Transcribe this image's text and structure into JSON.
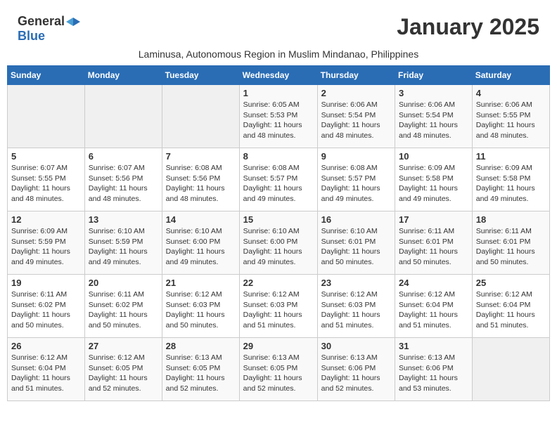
{
  "logo": {
    "general": "General",
    "blue": "Blue"
  },
  "title": "January 2025",
  "subtitle": "Laminusa, Autonomous Region in Muslim Mindanao, Philippines",
  "days_of_week": [
    "Sunday",
    "Monday",
    "Tuesday",
    "Wednesday",
    "Thursday",
    "Friday",
    "Saturday"
  ],
  "weeks": [
    [
      {
        "day": "",
        "sunrise": "",
        "sunset": "",
        "daylight": "",
        "empty": true
      },
      {
        "day": "",
        "sunrise": "",
        "sunset": "",
        "daylight": "",
        "empty": true
      },
      {
        "day": "",
        "sunrise": "",
        "sunset": "",
        "daylight": "",
        "empty": true
      },
      {
        "day": "1",
        "sunrise": "Sunrise: 6:05 AM",
        "sunset": "Sunset: 5:53 PM",
        "daylight": "Daylight: 11 hours and 48 minutes."
      },
      {
        "day": "2",
        "sunrise": "Sunrise: 6:06 AM",
        "sunset": "Sunset: 5:54 PM",
        "daylight": "Daylight: 11 hours and 48 minutes."
      },
      {
        "day": "3",
        "sunrise": "Sunrise: 6:06 AM",
        "sunset": "Sunset: 5:54 PM",
        "daylight": "Daylight: 11 hours and 48 minutes."
      },
      {
        "day": "4",
        "sunrise": "Sunrise: 6:06 AM",
        "sunset": "Sunset: 5:55 PM",
        "daylight": "Daylight: 11 hours and 48 minutes."
      }
    ],
    [
      {
        "day": "5",
        "sunrise": "Sunrise: 6:07 AM",
        "sunset": "Sunset: 5:55 PM",
        "daylight": "Daylight: 11 hours and 48 minutes."
      },
      {
        "day": "6",
        "sunrise": "Sunrise: 6:07 AM",
        "sunset": "Sunset: 5:56 PM",
        "daylight": "Daylight: 11 hours and 48 minutes."
      },
      {
        "day": "7",
        "sunrise": "Sunrise: 6:08 AM",
        "sunset": "Sunset: 5:56 PM",
        "daylight": "Daylight: 11 hours and 48 minutes."
      },
      {
        "day": "8",
        "sunrise": "Sunrise: 6:08 AM",
        "sunset": "Sunset: 5:57 PM",
        "daylight": "Daylight: 11 hours and 49 minutes."
      },
      {
        "day": "9",
        "sunrise": "Sunrise: 6:08 AM",
        "sunset": "Sunset: 5:57 PM",
        "daylight": "Daylight: 11 hours and 49 minutes."
      },
      {
        "day": "10",
        "sunrise": "Sunrise: 6:09 AM",
        "sunset": "Sunset: 5:58 PM",
        "daylight": "Daylight: 11 hours and 49 minutes."
      },
      {
        "day": "11",
        "sunrise": "Sunrise: 6:09 AM",
        "sunset": "Sunset: 5:58 PM",
        "daylight": "Daylight: 11 hours and 49 minutes."
      }
    ],
    [
      {
        "day": "12",
        "sunrise": "Sunrise: 6:09 AM",
        "sunset": "Sunset: 5:59 PM",
        "daylight": "Daylight: 11 hours and 49 minutes."
      },
      {
        "day": "13",
        "sunrise": "Sunrise: 6:10 AM",
        "sunset": "Sunset: 5:59 PM",
        "daylight": "Daylight: 11 hours and 49 minutes."
      },
      {
        "day": "14",
        "sunrise": "Sunrise: 6:10 AM",
        "sunset": "Sunset: 6:00 PM",
        "daylight": "Daylight: 11 hours and 49 minutes."
      },
      {
        "day": "15",
        "sunrise": "Sunrise: 6:10 AM",
        "sunset": "Sunset: 6:00 PM",
        "daylight": "Daylight: 11 hours and 49 minutes."
      },
      {
        "day": "16",
        "sunrise": "Sunrise: 6:10 AM",
        "sunset": "Sunset: 6:01 PM",
        "daylight": "Daylight: 11 hours and 50 minutes."
      },
      {
        "day": "17",
        "sunrise": "Sunrise: 6:11 AM",
        "sunset": "Sunset: 6:01 PM",
        "daylight": "Daylight: 11 hours and 50 minutes."
      },
      {
        "day": "18",
        "sunrise": "Sunrise: 6:11 AM",
        "sunset": "Sunset: 6:01 PM",
        "daylight": "Daylight: 11 hours and 50 minutes."
      }
    ],
    [
      {
        "day": "19",
        "sunrise": "Sunrise: 6:11 AM",
        "sunset": "Sunset: 6:02 PM",
        "daylight": "Daylight: 11 hours and 50 minutes."
      },
      {
        "day": "20",
        "sunrise": "Sunrise: 6:11 AM",
        "sunset": "Sunset: 6:02 PM",
        "daylight": "Daylight: 11 hours and 50 minutes."
      },
      {
        "day": "21",
        "sunrise": "Sunrise: 6:12 AM",
        "sunset": "Sunset: 6:03 PM",
        "daylight": "Daylight: 11 hours and 50 minutes."
      },
      {
        "day": "22",
        "sunrise": "Sunrise: 6:12 AM",
        "sunset": "Sunset: 6:03 PM",
        "daylight": "Daylight: 11 hours and 51 minutes."
      },
      {
        "day": "23",
        "sunrise": "Sunrise: 6:12 AM",
        "sunset": "Sunset: 6:03 PM",
        "daylight": "Daylight: 11 hours and 51 minutes."
      },
      {
        "day": "24",
        "sunrise": "Sunrise: 6:12 AM",
        "sunset": "Sunset: 6:04 PM",
        "daylight": "Daylight: 11 hours and 51 minutes."
      },
      {
        "day": "25",
        "sunrise": "Sunrise: 6:12 AM",
        "sunset": "Sunset: 6:04 PM",
        "daylight": "Daylight: 11 hours and 51 minutes."
      }
    ],
    [
      {
        "day": "26",
        "sunrise": "Sunrise: 6:12 AM",
        "sunset": "Sunset: 6:04 PM",
        "daylight": "Daylight: 11 hours and 51 minutes."
      },
      {
        "day": "27",
        "sunrise": "Sunrise: 6:12 AM",
        "sunset": "Sunset: 6:05 PM",
        "daylight": "Daylight: 11 hours and 52 minutes."
      },
      {
        "day": "28",
        "sunrise": "Sunrise: 6:13 AM",
        "sunset": "Sunset: 6:05 PM",
        "daylight": "Daylight: 11 hours and 52 minutes."
      },
      {
        "day": "29",
        "sunrise": "Sunrise: 6:13 AM",
        "sunset": "Sunset: 6:05 PM",
        "daylight": "Daylight: 11 hours and 52 minutes."
      },
      {
        "day": "30",
        "sunrise": "Sunrise: 6:13 AM",
        "sunset": "Sunset: 6:06 PM",
        "daylight": "Daylight: 11 hours and 52 minutes."
      },
      {
        "day": "31",
        "sunrise": "Sunrise: 6:13 AM",
        "sunset": "Sunset: 6:06 PM",
        "daylight": "Daylight: 11 hours and 53 minutes."
      },
      {
        "day": "",
        "sunrise": "",
        "sunset": "",
        "daylight": "",
        "empty": true
      }
    ]
  ]
}
